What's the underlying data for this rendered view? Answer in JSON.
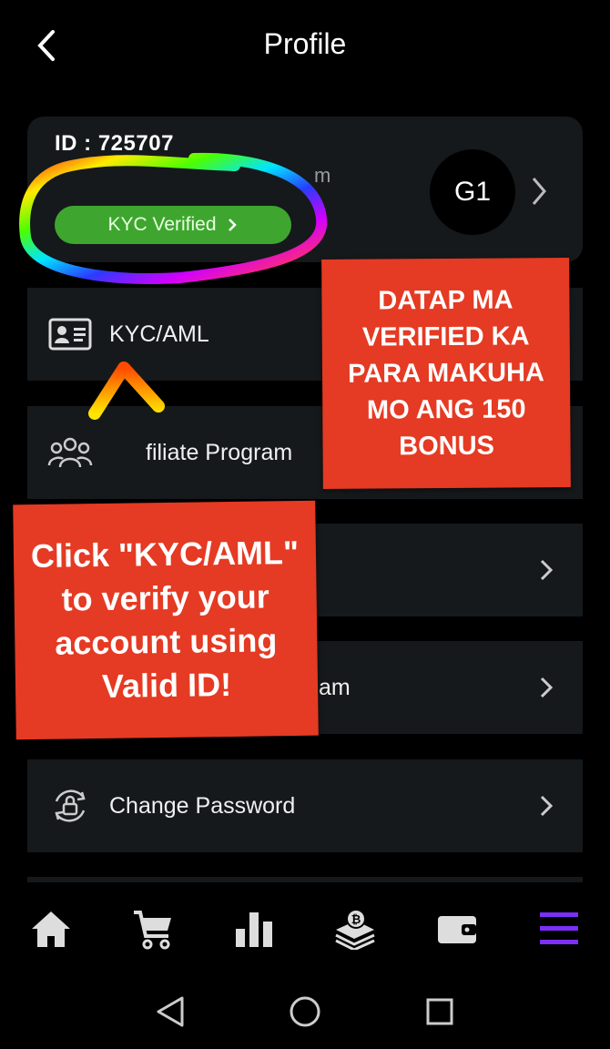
{
  "header": {
    "title": "Profile"
  },
  "profile": {
    "id_label": "ID : 725707",
    "name_visible": "m",
    "kyc_badge": "KYC Verified",
    "avatar_initials": "G1"
  },
  "menu": {
    "items": [
      {
        "label": "KYC/AML",
        "icon": "id-card-icon"
      },
      {
        "label": "filiate Program",
        "icon": "users-group-icon"
      },
      {
        "label": "",
        "icon": ""
      },
      {
        "label": "am",
        "icon": ""
      },
      {
        "label": "Change Password",
        "icon": "lock-refresh-icon"
      }
    ]
  },
  "annotations": {
    "right_note": "DATAP MA VERIFIED KA PARA MAKUHA MO ANG 150 BONUS",
    "left_note": "Click \"KYC/AML\" to verify your account using Valid ID!"
  },
  "bottom_nav": {
    "items": [
      "home-icon",
      "cart-icon",
      "bar-chart-icon",
      "bitcoin-cash-icon",
      "wallet-icon",
      "menu-icon"
    ],
    "active_color": "#7b2ff7"
  },
  "colors": {
    "badge_green": "#3ea62f",
    "note_red": "#e53a23",
    "card_bg": "#15191b"
  }
}
